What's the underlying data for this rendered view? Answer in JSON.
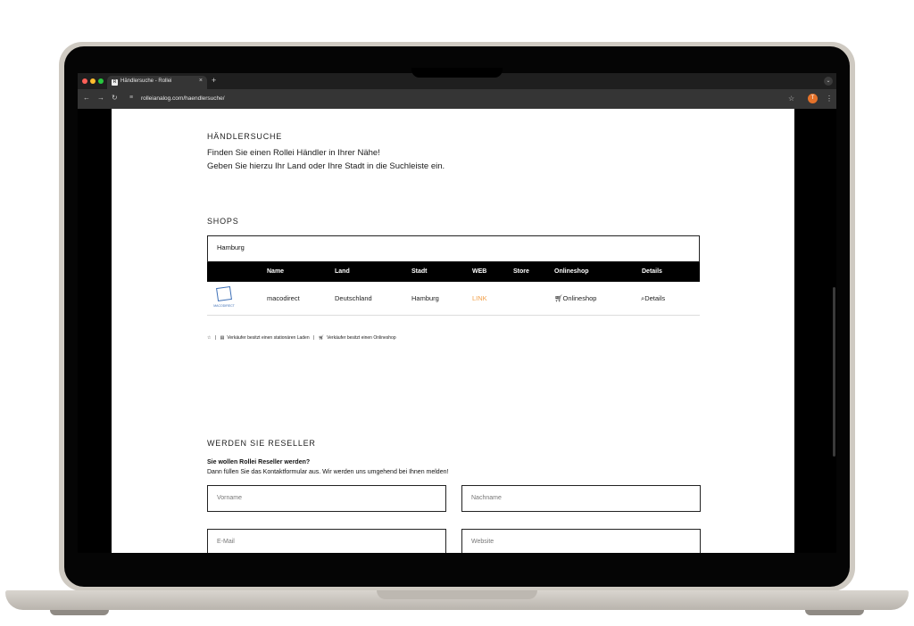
{
  "browser": {
    "tab_title": "Händlersuche - Rollei",
    "favicon_glyph": "R",
    "tab_close": "×",
    "new_tab": "+",
    "url": "rolleianalog.com/haendlersuche/",
    "profile_initial": "T",
    "icons": {
      "back": "back-arrow-icon",
      "forward": "forward-arrow-icon",
      "reload": "reload-icon",
      "site_settings": "tune-icon",
      "bookmark": "star-icon",
      "menu": "kebab-menu-icon",
      "extensions": "chevron-down-icon"
    },
    "colors": {
      "close": "#ff5f57",
      "minimize": "#febc2e",
      "maximize": "#28c840",
      "profile": "#e4722a"
    }
  },
  "page": {
    "dealer_search": {
      "heading": "HÄNDLERSUCHE",
      "line1": "Finden Sie einen Rollei Händler in Ihrer Nähe!",
      "line2": "Geben Sie hierzu Ihr Land oder Ihre Stadt in die Suchleiste ein."
    },
    "shops": {
      "heading": "SHOPS",
      "search_value": "Hamburg",
      "columns": [
        "Name",
        "Land",
        "Stadt",
        "WEB",
        "Store",
        "Onlineshop",
        "Details"
      ],
      "rows": [
        {
          "logo_text": "MACODIRECT",
          "name": "macodirect",
          "land": "Deutschland",
          "stadt": "Hamburg",
          "web": "LINK",
          "store": "",
          "onlineshop": "Onlineshop",
          "details": "Details"
        }
      ],
      "link_color": "#f2a04a",
      "legend": {
        "separator": "|",
        "store_text": "Verkäufer besitzt einen stationären Laden",
        "online_text": "Verkäufer besitzt einen Onlineshop"
      }
    },
    "reseller": {
      "heading": "WERDEN SIE RESELLER",
      "subheading": "Sie wollen Rollei Reseller werden?",
      "text": "Dann füllen Sie das Kontaktformular aus. Wir werden uns umgehend bei Ihnen melden!",
      "fields": {
        "firstname": "Vorname",
        "lastname": "Nachname",
        "email": "E-Mail",
        "website": "Website"
      }
    }
  }
}
